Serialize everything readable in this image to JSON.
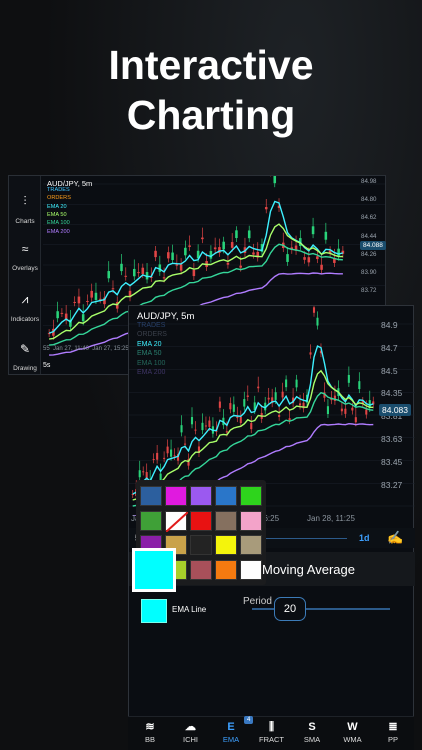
{
  "headline": {
    "line1": "Interactive",
    "line2": "Charting"
  },
  "panel1": {
    "symbol_title": "AUD/JPY, 5m",
    "legend": [
      {
        "label": "TRADES",
        "color": "#3fc7ff"
      },
      {
        "label": "ORDERS",
        "color": "#ff9f1a"
      },
      {
        "label": "EMA 20",
        "color": "#3ef0ff"
      },
      {
        "label": "EMA 50",
        "color": "#a9ff6a"
      },
      {
        "label": "EMA 100",
        "color": "#35d69a"
      },
      {
        "label": "EMA 200",
        "color": "#b07cff"
      }
    ],
    "y_ticks": [
      "84.98",
      "84.80",
      "84.62",
      "84.44",
      "84.26",
      "83.90",
      "83.72",
      "83.54",
      "83.36"
    ],
    "price_tag": "84.088",
    "x_labels": [
      "55",
      "Jan 27, 11:40",
      "Jan 27, 15:25"
    ],
    "sidebar": [
      {
        "icon": "candlestick-icon",
        "glyph": "⫶",
        "label": "Charts"
      },
      {
        "icon": "waves-icon",
        "glyph": "≈",
        "label": "Overlays"
      },
      {
        "icon": "zigzag-icon",
        "glyph": "⩘",
        "label": "Indicators"
      },
      {
        "icon": "pencil-icon",
        "glyph": "✎",
        "label": "Drawing"
      }
    ],
    "timeframe": "5s"
  },
  "panel2": {
    "symbol_title": "AUD/JPY, 5m",
    "legend": [
      {
        "label": "TRADES",
        "color": "#28416a"
      },
      {
        "label": "ORDERS",
        "color": "#3a3f4a"
      },
      {
        "label": "EMA 20",
        "color": "#3ef0ff"
      },
      {
        "label": "EMA 50",
        "color": "#2a7f6f"
      },
      {
        "label": "EMA 100",
        "color": "#24665a"
      },
      {
        "label": "EMA 200",
        "color": "#3f3566"
      }
    ],
    "y_ticks": [
      "84.9",
      "84.7",
      "84.5",
      "84.35",
      "83.81",
      "83.63",
      "83.45",
      "83.27"
    ],
    "price_tag": "84.083",
    "x_labels": [
      "Jan",
      "06:25",
      "Jan 28, 11:25"
    ],
    "timeframe_left": "5",
    "timeframe_right": "1d"
  },
  "color_picker": {
    "swatches": [
      "#2c5f9e",
      "#e01adf",
      "#9b59f0",
      "#2a76c9",
      "#2ed41c",
      "#3fa037",
      "none",
      "#e81212",
      "#85705f",
      "#f3a3c9",
      "#8b1fa8",
      "#c9a24a",
      "#232323",
      "#f4f40c",
      "#a89b7b",
      "#00ffff",
      "#a8cf2a",
      "#a8505a",
      "#f47a10",
      "#ffffff"
    ],
    "selected": "#00ffff"
  },
  "ema_settings": {
    "title": "Moving Average",
    "line_label": "EMA Line",
    "line_color": "#00ffff",
    "period_label": "Period",
    "period_value": "20"
  },
  "tabs": [
    {
      "icon": "bb-icon",
      "glyph": "≋",
      "label": "BB"
    },
    {
      "icon": "ichi-icon",
      "glyph": "☁",
      "label": "ICHI"
    },
    {
      "icon": "ema-icon",
      "glyph": "E",
      "label": "EMA",
      "active": true
    },
    {
      "icon": "fract-icon",
      "glyph": "⫼",
      "label": "FRACT"
    },
    {
      "icon": "sma-icon",
      "glyph": "S",
      "label": "SMA"
    },
    {
      "icon": "wma-icon",
      "glyph": "W",
      "label": "WMA"
    },
    {
      "icon": "pp-icon",
      "glyph": "≣",
      "label": "PP"
    }
  ],
  "ema_badge": "4",
  "accent": "#3ea0ff"
}
